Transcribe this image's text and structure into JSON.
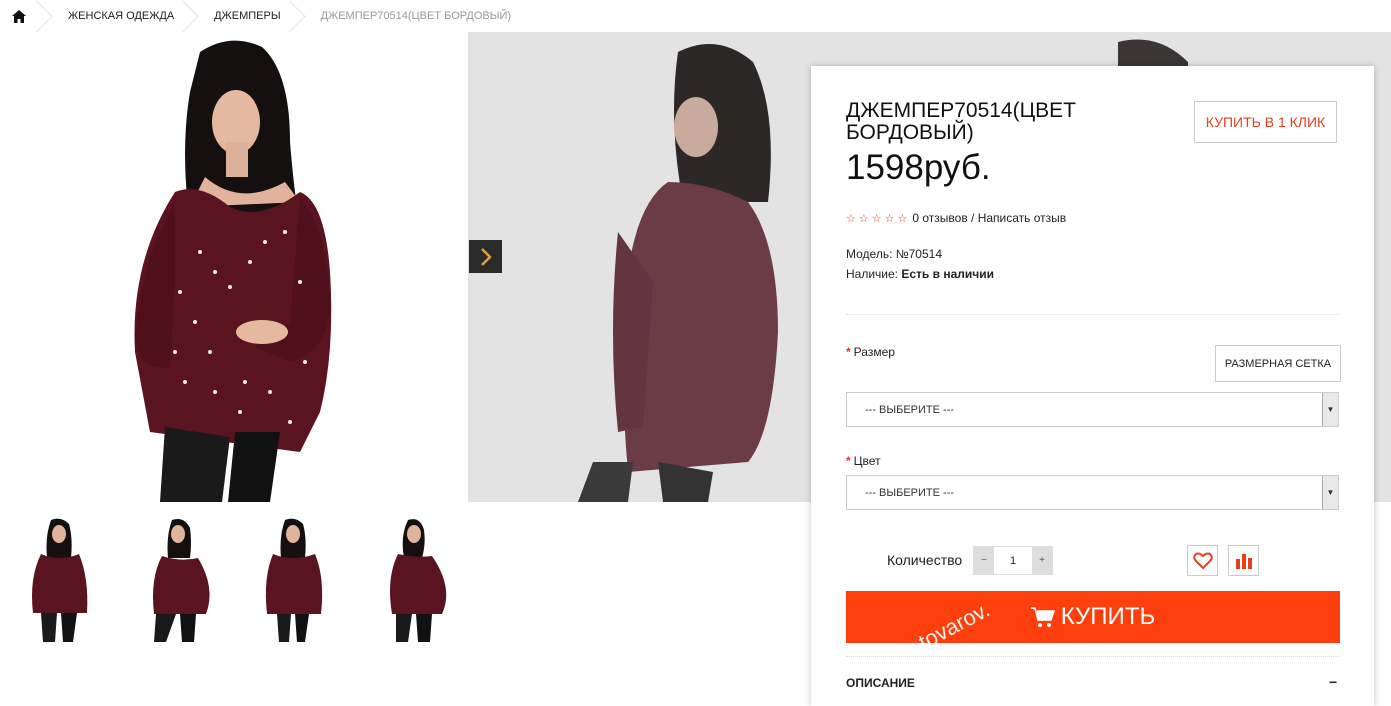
{
  "breadcrumb": {
    "items": [
      "ЖЕНСКАЯ ОДЕЖДА",
      "ДЖЕМПЕРЫ"
    ],
    "current": "ДЖЕМПЕР70514(ЦВЕТ БОРДОВЫЙ)"
  },
  "product": {
    "title": "ДЖЕМПЕР70514(ЦВЕТ БОРДОВЫЙ)",
    "price": "1598руб.",
    "buy_one_click": "КУПИТЬ В 1 КЛИК",
    "rating": 0,
    "reviews": "0 отзывов / Написать отзыв",
    "model_label": "Модель:",
    "model_value": "№70514",
    "availability_label": "Наличие:",
    "availability_value": "Есть в наличии"
  },
  "options": {
    "size_label": "Размер",
    "size_chart_button": "РАЗМЕРНАЯ СЕТКА",
    "size_select": "--- ВЫБЕРИТЕ ---",
    "color_label": "Цвет",
    "color_select": "--- ВЫБЕРИТЕ ---",
    "required_mark": "*"
  },
  "quantity": {
    "label": "Количество",
    "value": "1",
    "minus": "−",
    "plus": "+"
  },
  "buy_button": "КУПИТЬ",
  "watermark": "tovarov.",
  "description_heading": "ОПИСАНИЕ",
  "description_toggle": "−",
  "colors": {
    "accent": "#fc3f0c",
    "sweater": "#5a1420",
    "star": "#e83e1d"
  },
  "icons": [
    "home-icon",
    "chevron-right-icon",
    "heart-icon",
    "compare-icon",
    "cart-icon"
  ]
}
